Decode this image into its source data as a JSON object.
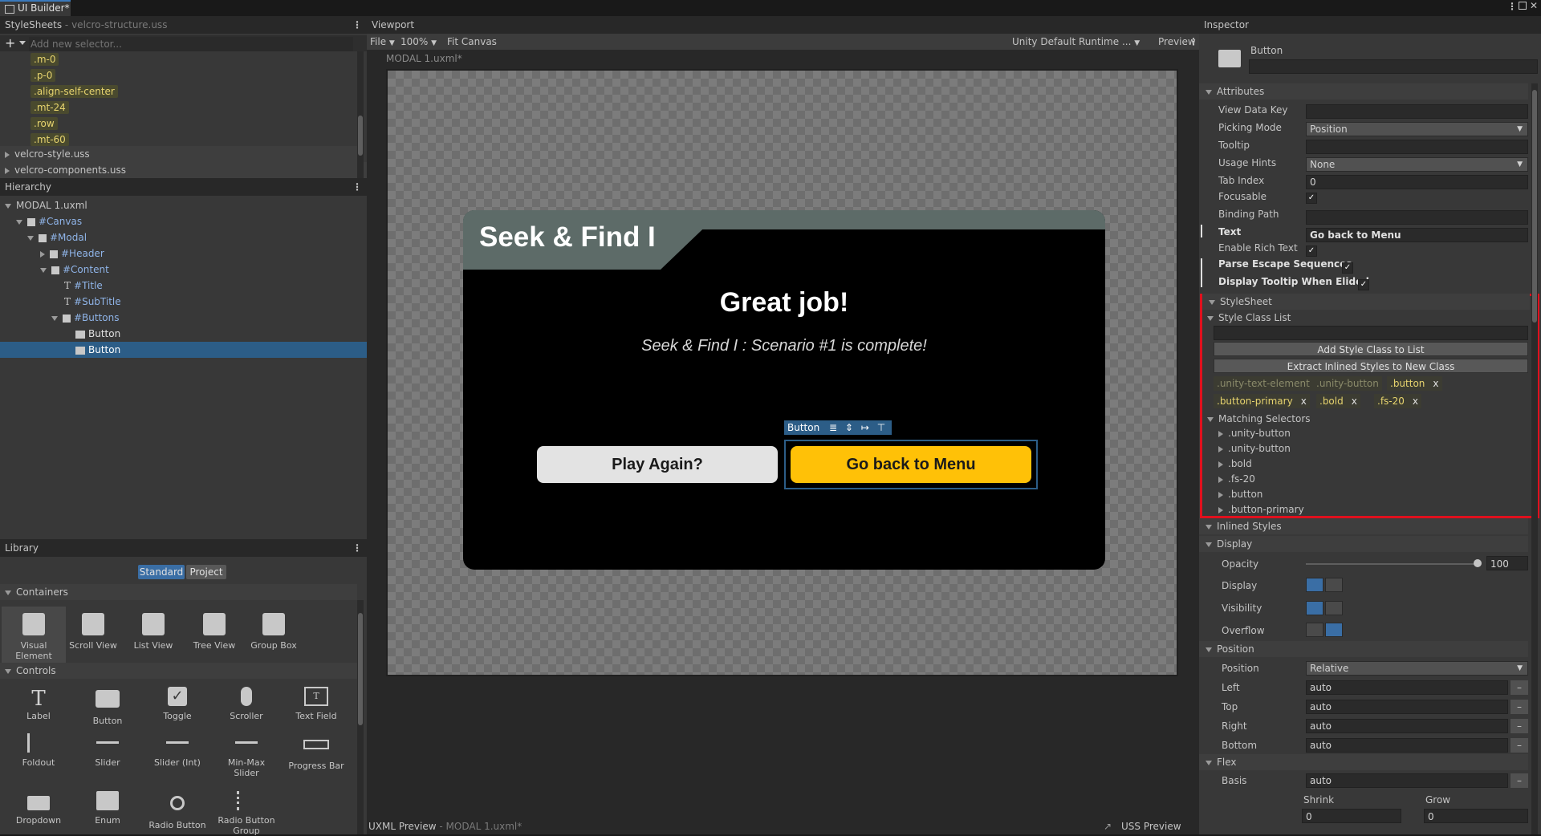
{
  "window": {
    "tab_title": "UI Builder*"
  },
  "stylesheets": {
    "header_title": "StyleSheets",
    "header_file": "velcro-structure.uss",
    "add_selector_placeholder": "Add new selector...",
    "selectors": [
      ".m-0",
      ".p-0",
      ".align-self-center",
      ".mt-24",
      ".row",
      ".mt-60"
    ],
    "files": [
      "velcro-style.uss",
      "velcro-components.uss"
    ]
  },
  "hierarchy": {
    "title": "Hierarchy",
    "root": "MODAL 1.uxml",
    "nodes": [
      "#Canvas",
      "#Modal",
      "#Header",
      "#Content",
      "#Title",
      "#SubTitle",
      "#Buttons",
      "Button",
      "Button"
    ]
  },
  "library": {
    "title": "Library",
    "tabs": [
      "Standard",
      "Project"
    ],
    "containers_label": "Containers",
    "containers": [
      "Visual Element",
      "Scroll View",
      "List View",
      "Tree View",
      "Group Box"
    ],
    "controls_label": "Controls",
    "controls": [
      "Label",
      "Button",
      "Toggle",
      "Scroller",
      "Text Field",
      "Foldout",
      "Slider",
      "Slider (Int)",
      "Min-Max Slider",
      "Progress Bar",
      "Dropdown",
      "Enum",
      "Radio Button",
      "Radio Button Group"
    ]
  },
  "viewport": {
    "title": "Viewport",
    "file_menu": "File",
    "zoom": "100%",
    "fit_canvas": "Fit Canvas",
    "theme": "Unity Default Runtime ...",
    "preview": "Preview",
    "canvas_label": "MODAL 1.uxml*",
    "bottom_uxml": "UXML Preview",
    "bottom_uxml_file": "MODAL 1.uxml*",
    "bottom_uss": "USS Preview"
  },
  "modal": {
    "header": "Seek & Find I",
    "title": "Great job!",
    "subtitle": "Seek & Find I : Scenario #1 is complete!",
    "btn_secondary": "Play Again?",
    "btn_primary": "Go back to Menu",
    "selection_tag": "Button"
  },
  "inspector": {
    "title": "Inspector",
    "element_type": "Button",
    "attributes_label": "Attributes",
    "attrs": {
      "view_data_key": "View Data Key",
      "picking_mode": "Picking Mode",
      "picking_mode_value": "Position",
      "tooltip": "Tooltip",
      "usage_hints": "Usage Hints",
      "usage_hints_value": "None",
      "tab_index": "Tab Index",
      "tab_index_value": "0",
      "focusable": "Focusable",
      "binding_path": "Binding Path",
      "text": "Text",
      "text_value": "Go back to Menu",
      "enable_rich_text": "Enable Rich Text",
      "parse_escape": "Parse Escape Sequences",
      "display_tooltip": "Display Tooltip When Elided"
    },
    "stylesheet_label": "StyleSheet",
    "style_class_list_label": "Style Class List",
    "add_style_class": "Add Style Class to List",
    "extract_inline": "Extract Inlined Styles to New Class",
    "classes": [
      ".unity-text-element",
      ".unity-button",
      ".button",
      ".button-primary",
      ".bold",
      ".fs-20"
    ],
    "class_remove": "x",
    "matching_selectors_label": "Matching Selectors",
    "matching": [
      ".unity-button",
      ".unity-button",
      ".bold",
      ".fs-20",
      ".button",
      ".button-primary"
    ],
    "inlined_styles_label": "Inlined Styles",
    "display_label": "Display",
    "opacity_label": "Opacity",
    "opacity_value": "100",
    "display_field": "Display",
    "visibility_field": "Visibility",
    "overflow_field": "Overflow",
    "position_label": "Position",
    "position_field": "Position",
    "position_value": "Relative",
    "left": "Left",
    "top": "Top",
    "right": "Right",
    "bottom": "Bottom",
    "auto": "auto",
    "flex_label": "Flex",
    "basis": "Basis",
    "shrink": "Shrink",
    "grow": "Grow",
    "zero": "0"
  },
  "colors": {
    "accent": "#2c5d87",
    "primary_button": "#ffc107",
    "highlight_box": "#e0101d"
  }
}
